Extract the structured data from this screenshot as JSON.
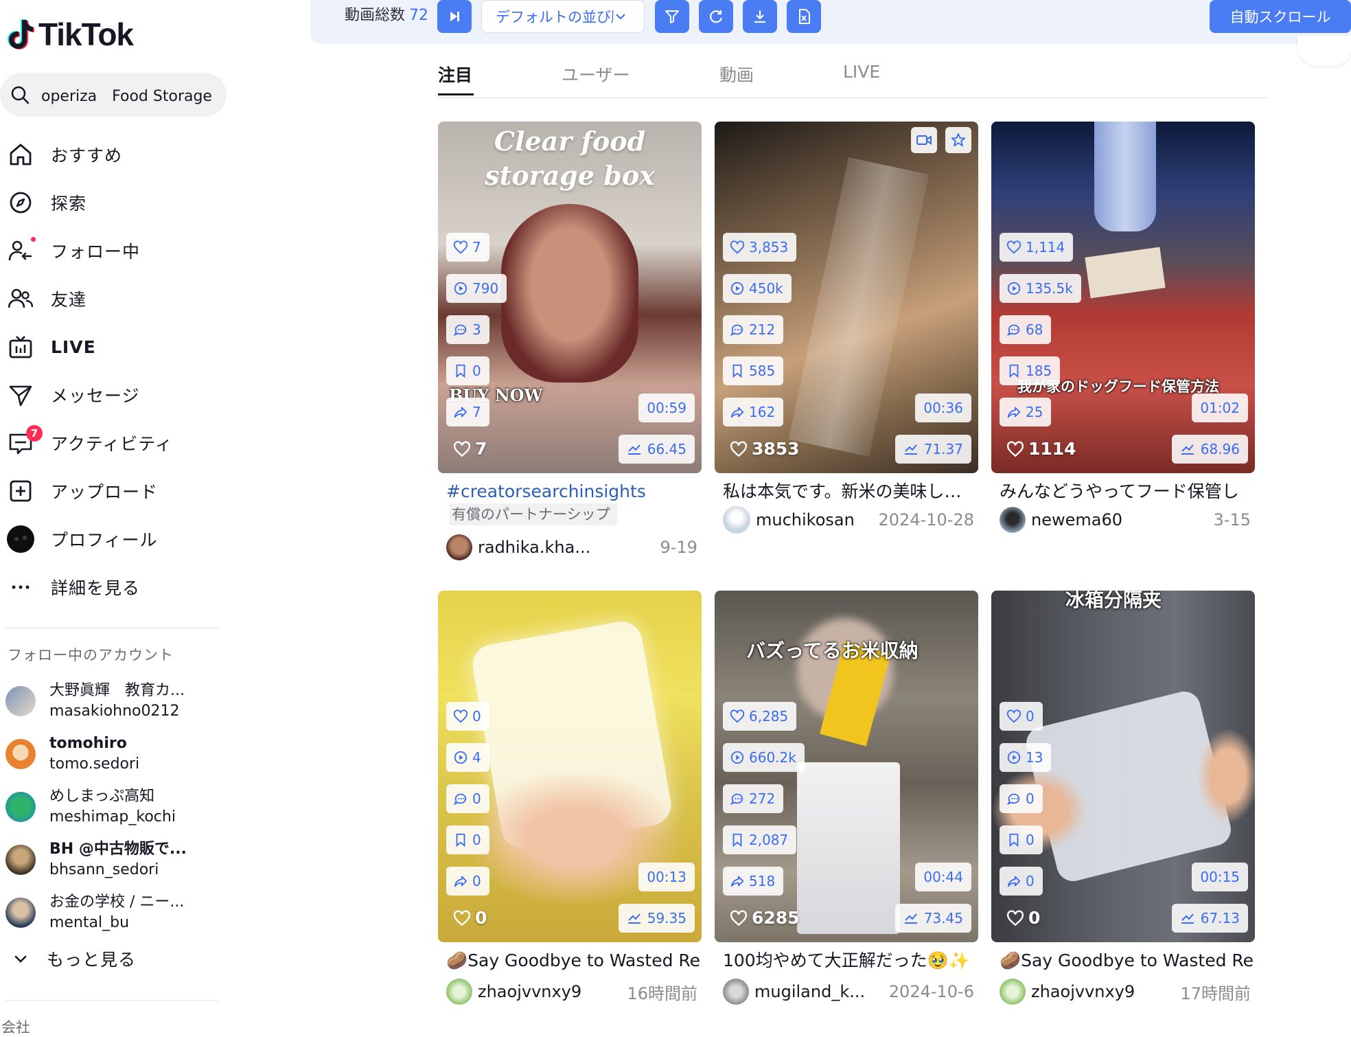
{
  "app": {
    "logo_text": "TikTok"
  },
  "search": {
    "query": "operiza　Food Storage"
  },
  "nav": [
    {
      "label": "おすすめ",
      "icon": "home-icon"
    },
    {
      "label": "探索",
      "icon": "compass-icon"
    },
    {
      "label": "フォロー中",
      "icon": "following-icon",
      "dot": true
    },
    {
      "label": "友達",
      "icon": "friends-icon"
    },
    {
      "label": "LIVE",
      "icon": "live-icon"
    },
    {
      "label": "メッセージ",
      "icon": "message-icon"
    },
    {
      "label": "アクティビティ",
      "icon": "activity-icon",
      "badge": "7"
    },
    {
      "label": "アップロード",
      "icon": "upload-icon"
    },
    {
      "label": "プロフィール",
      "icon": "profile-avatar"
    },
    {
      "label": "詳細を見る",
      "icon": "more-icon"
    }
  ],
  "following": {
    "title": "フォロー中のアカウント",
    "accounts": [
      {
        "name": "大野眞輝　教育カ...",
        "id": "masakiohno0212"
      },
      {
        "name": "tomohiro",
        "id": "tomo.sedori"
      },
      {
        "name": "めしまっぷ高知",
        "id": "meshimap_kochi"
      },
      {
        "name": "BH @中古物販で...",
        "id": "bhsann_sedori"
      },
      {
        "name": "お金の学校 / ニー...",
        "id": "mental_bu"
      }
    ],
    "more_label": "もっと見る"
  },
  "company_label": "会社",
  "toolbar": {
    "count_label": "動画総数",
    "count_value": "72",
    "sort_label": "デフォルトの並び順",
    "auto_scroll_label": "自動スクロール"
  },
  "tabs": [
    "注目",
    "ユーザー",
    "動画",
    "LIVE"
  ],
  "videos": [
    {
      "overlay_line1": "Clear food",
      "overlay_line2": "storage box",
      "overlay_extra": "BUY NOW",
      "likes": "7",
      "views": "790",
      "comments": "3",
      "saves": "0",
      "shares": "7",
      "duration": "00:59",
      "score": "66.45",
      "likes_big": "7",
      "title": "#creatorsearchinsights",
      "partner": "有償のパートナーシップ",
      "user": "radhika.kha...",
      "date": "9-19"
    },
    {
      "likes": "3,853",
      "views": "450k",
      "comments": "212",
      "saves": "585",
      "shares": "162",
      "duration": "00:36",
      "score": "71.37",
      "likes_big": "3853",
      "title": "私は本気です。新米の美味しさを保つための最強のお米保存",
      "user": "muchikosan",
      "date": "2024-10-28"
    },
    {
      "overlay_jp": "我が家のドッグフード保管方法",
      "likes": "1,114",
      "views": "135.5k",
      "comments": "68",
      "saves": "185",
      "shares": "25",
      "duration": "01:02",
      "score": "68.96",
      "likes_big": "1114",
      "title": "みんなどうやってフード保管してる？",
      "user": "newema60",
      "date": "3-15"
    },
    {
      "likes": "0",
      "views": "4",
      "comments": "0",
      "saves": "0",
      "shares": "0",
      "duration": "00:13",
      "score": "59.35",
      "likes_big": "0",
      "title": "🥔Say Goodbye to Wasted Refrigerator Space",
      "user": "zhaojvvnxy9",
      "date": "16時間前"
    },
    {
      "overlay_jp": "バズってるお米収納",
      "likes": "6,285",
      "views": "660.2k",
      "comments": "272",
      "saves": "2,087",
      "shares": "518",
      "duration": "00:44",
      "score": "73.45",
      "likes_big": "6285",
      "title": "100均やめて大正解だった🥹✨",
      "user": "mugiland_k...",
      "date": "2024-10-6"
    },
    {
      "overlay_jp": "冰箱分隔夹",
      "likes": "0",
      "views": "13",
      "comments": "0",
      "saves": "0",
      "shares": "0",
      "duration": "00:15",
      "score": "67.13",
      "likes_big": "0",
      "title": "🥔Say Goodbye to Wasted Refrigerator Space",
      "user": "zhaojvvnxy9",
      "date": "17時間前"
    }
  ]
}
